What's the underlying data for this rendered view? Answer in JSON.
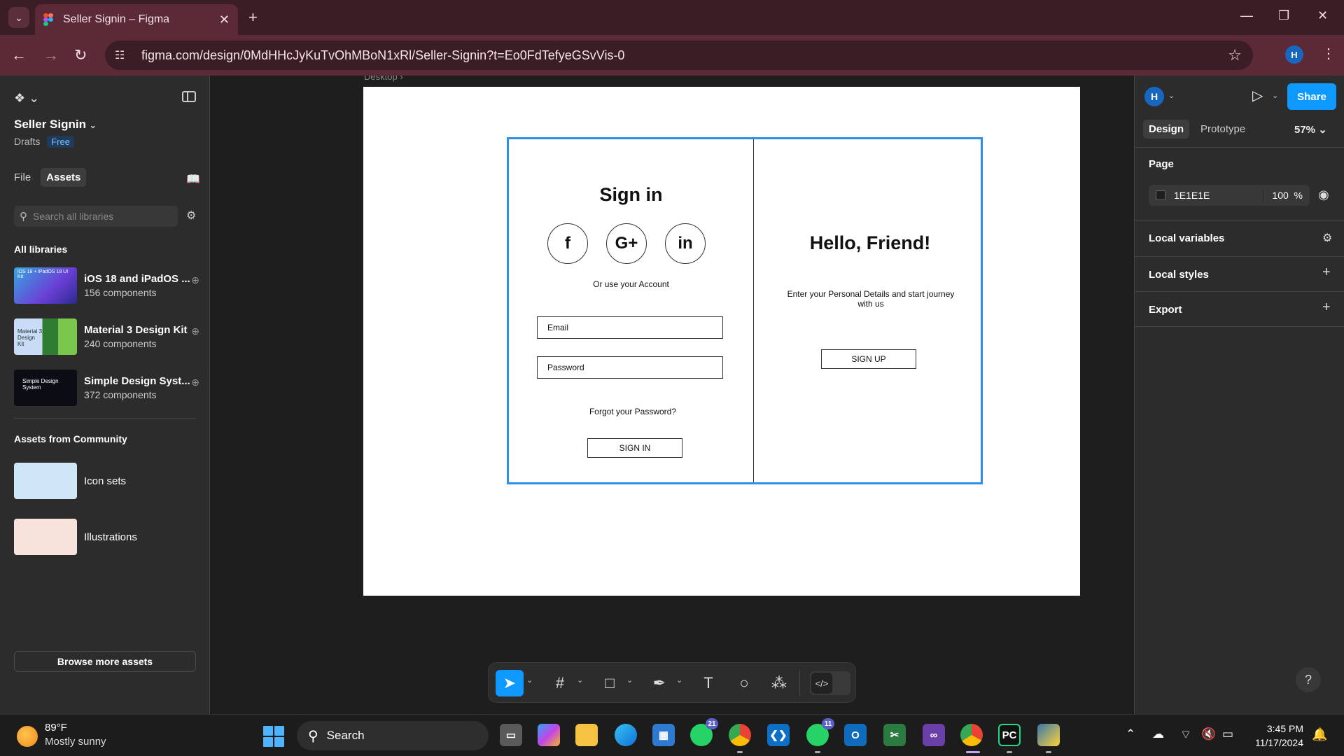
{
  "browser": {
    "tab_title": "Seller Signin – Figma",
    "url": "figma.com/design/0MdHHcJyKuTvOhMBoN1xRl/Seller-Signin?t=Eo0FdTefyeGSvVis-0",
    "profile_initial": "H"
  },
  "left_panel": {
    "file_name": "Seller Signin",
    "drafts": "Drafts",
    "plan_badge": "Free",
    "tabs": [
      "File",
      "Assets"
    ],
    "search_placeholder": "Search all libraries",
    "all_libraries_title": "All libraries",
    "libraries": [
      {
        "name": "iOS 18 and iPadOS ...",
        "count": "156 components",
        "thumb_text": "iOS 18 + iPadOS 18 UI Kit"
      },
      {
        "name": "Material 3 Design Kit",
        "count": "240 components",
        "thumb_text": "Material 3 Design Kit"
      },
      {
        "name": "Simple Design Syst...",
        "count": "372 components",
        "thumb_text": "Simple Design System"
      }
    ],
    "community_title": "Assets from Community",
    "community": [
      {
        "name": "Icon sets"
      },
      {
        "name": "Illustrations"
      }
    ],
    "browse_button": "Browse more assets"
  },
  "canvas": {
    "frame_label": "Desktop",
    "design": {
      "signin_title": "Sign in",
      "socials": [
        "f",
        "G+",
        "in"
      ],
      "or_text": "Or use your Account",
      "email_placeholder": "Email",
      "password_placeholder": "Password",
      "forgot_text": "Forgot your Password?",
      "signin_button": "SIGN IN",
      "hello_title": "Hello, Friend!",
      "hello_sub": "Enter your Personal Details and start journey with us",
      "signup_button": "SIGN UP"
    }
  },
  "right_panel": {
    "avatar_initial": "H",
    "share_button": "Share",
    "tabs": [
      "Design",
      "Prototype"
    ],
    "zoom": "57%",
    "page_title": "Page",
    "page_color": "1E1E1E",
    "page_opacity": "100",
    "percent": "%",
    "sections": [
      "Local variables",
      "Local styles",
      "Export"
    ],
    "help": "?"
  },
  "taskbar": {
    "temperature": "89°F",
    "condition": "Mostly sunny",
    "search_label": "Search",
    "whatsapp_badge": "21",
    "whatsapp2_badge": "11",
    "time": "3:45 PM",
    "date": "11/17/2024"
  },
  "colors": {
    "accent": "#0d99ff",
    "selection": "#2f8ee6",
    "browser_frame": "#5c2a37"
  }
}
